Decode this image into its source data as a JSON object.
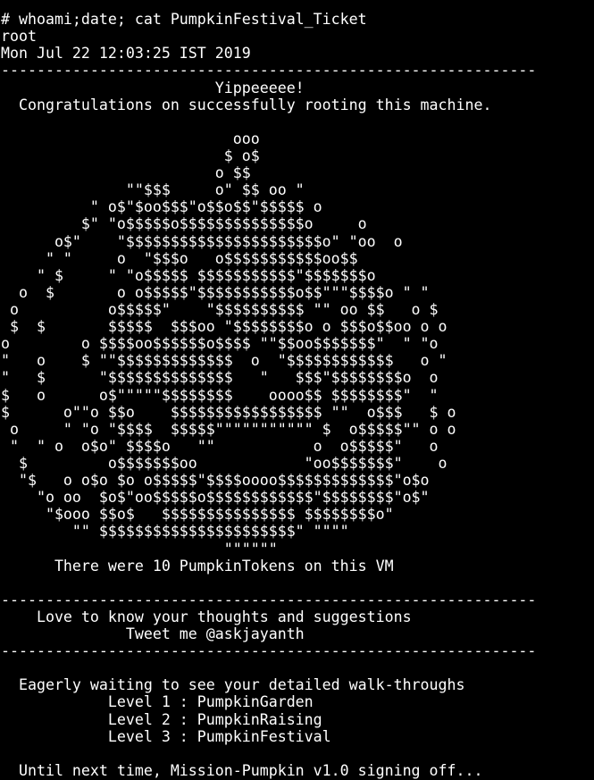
{
  "terminal": {
    "colors": {
      "background": "#000000",
      "foreground": "#ffffff"
    },
    "lines": [
      "  ",
      "# whoami;date; cat PumpkinFestival_Ticket",
      "root",
      "Mon Jul 22 12:03:25 IST 2019",
      "------------------------------------------------------------",
      "                        Yippeeeee!",
      "  Congratulations on successfully rooting this machine.",
      "",
      "                          ooo",
      "                         $ o$",
      "                        o $$",
      "              \"\"$$$     o\" $$ oo \"",
      "          \" o$\"$oo$$$\"o$$o$$\"$$$$$ o",
      "         $\" \"o$$$$$o$$$$$$$$$$$$$$o     o",
      "      o$\"    \"$$$$$$$$$$$$$$$$$$$$$$o\" \"oo  o",
      "     \" \"     o  \"$$$o   o$$$$$$$$$$$oo$$",
      "    \" $     \" \"o$$$$$ $$$$$$$$$$$\"$$$$$$$o",
      "  o  $       o o$$$$$\"$$$$$$$$$$$o$$\"\"\"$$$$o \" \"",
      " o          o$$$$$\"    \"$$$$$$$$$$ \"\" oo $$   o $",
      " $  $       $$$$$  $$$oo \"$$$$$$$$o o $$$o$$oo o o",
      "o        o $$$$oo$$$$$$o$$$$ \"\"$$oo$$$$$$$\"  \" \"o",
      "\"   o    $ \"\"$$$$$$$$$$$$$  o  \"$$$$$$$$$$$$   o \"",
      "\"   $      \"$$$$$$$$$$$$$$   \"   $$$\"$$$$$$$$o  o",
      "$   o      o$\"\"\"\"\"$$$$$$$$    oooo$$ $$$$$$$$\"  \"",
      "$      o\"\"o $$o    $$$$$$$$$$$$$$$$$ \"\"  o$$$   $ o",
      " o     \" \"o \"$$$$  $$$$$\"\"\"\"\"\"\"\"\"\"\" $  o$$$$$\"\" o o",
      " \"  \" o  o$o\" $$$$o   \"\"           o  o$$$$$\"   o",
      "  $         o$$$$$$$oo            \"oo$$$$$$$\"    o",
      "  \"$   o o$o $o o$$$$$\"$$$$oooo$$$$$$$$$$$$$\"o$o",
      "    \"o oo  $o$\"oo$$$$$o$$$$$$$$$$$$\"$$$$$$$$\"o$\"",
      "     \"$ooo $$o$   $$$$$$$$$$$$$$$ $$$$$$$$o\"",
      "        \"\" $$$$$$$$$$$$$$$$$$$$$$\" \"\"\"\"",
      "                         \"\"\"\"\"\"",
      "      There were 10 PumpkinTokens on this VM",
      "",
      "------------------------------------------------------------",
      "    Love to know your thoughts and suggestions",
      "              Tweet me @askjayanth",
      "------------------------------------------------------------",
      "",
      "  Eagerly waiting to see your detailed walk-throughs",
      "            Level 1 : PumpkinGarden",
      "            Level 2 : PumpkinRaising",
      "            Level 3 : PumpkinFestival",
      "",
      "  Until next time, Mission-Pumpkin v1.0 signing off..."
    ]
  }
}
